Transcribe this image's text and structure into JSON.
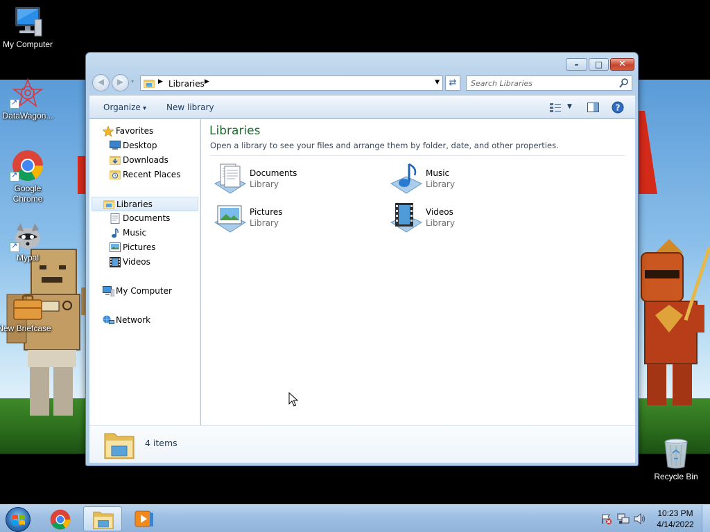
{
  "desktop": {
    "icons": [
      {
        "label": "My Computer"
      },
      {
        "label": "DataWagon..."
      },
      {
        "label": "Google Chrome"
      },
      {
        "label": "Mypal"
      },
      {
        "label": "New Briefcase"
      },
      {
        "label": "Recycle Bin"
      }
    ]
  },
  "window": {
    "address": {
      "segments": [
        "Libraries"
      ]
    },
    "search": {
      "placeholder": "Search Libraries"
    },
    "commands": {
      "organize": "Organize",
      "new_library": "New library"
    },
    "nav": {
      "favorites": {
        "label": "Favorites",
        "items": [
          "Desktop",
          "Downloads",
          "Recent Places"
        ]
      },
      "libraries": {
        "label": "Libraries",
        "items": [
          "Documents",
          "Music",
          "Pictures",
          "Videos"
        ]
      },
      "computer": "My Computer",
      "network": "Network"
    },
    "content": {
      "title": "Libraries",
      "subtitle": "Open a library to see your files and arrange them by folder, date, and other properties.",
      "libraries": [
        {
          "name": "Documents",
          "type": "Library"
        },
        {
          "name": "Music",
          "type": "Library"
        },
        {
          "name": "Pictures",
          "type": "Library"
        },
        {
          "name": "Videos",
          "type": "Library"
        }
      ]
    },
    "details": {
      "count": "4 items"
    }
  },
  "taskbar": {
    "clock": {
      "time": "10:23 PM",
      "date": "4/14/2022"
    }
  },
  "colors": {
    "title_green": "#1e6e2e",
    "taskbar": "#9ebfe3",
    "window_frame": "#b8d1ea"
  }
}
